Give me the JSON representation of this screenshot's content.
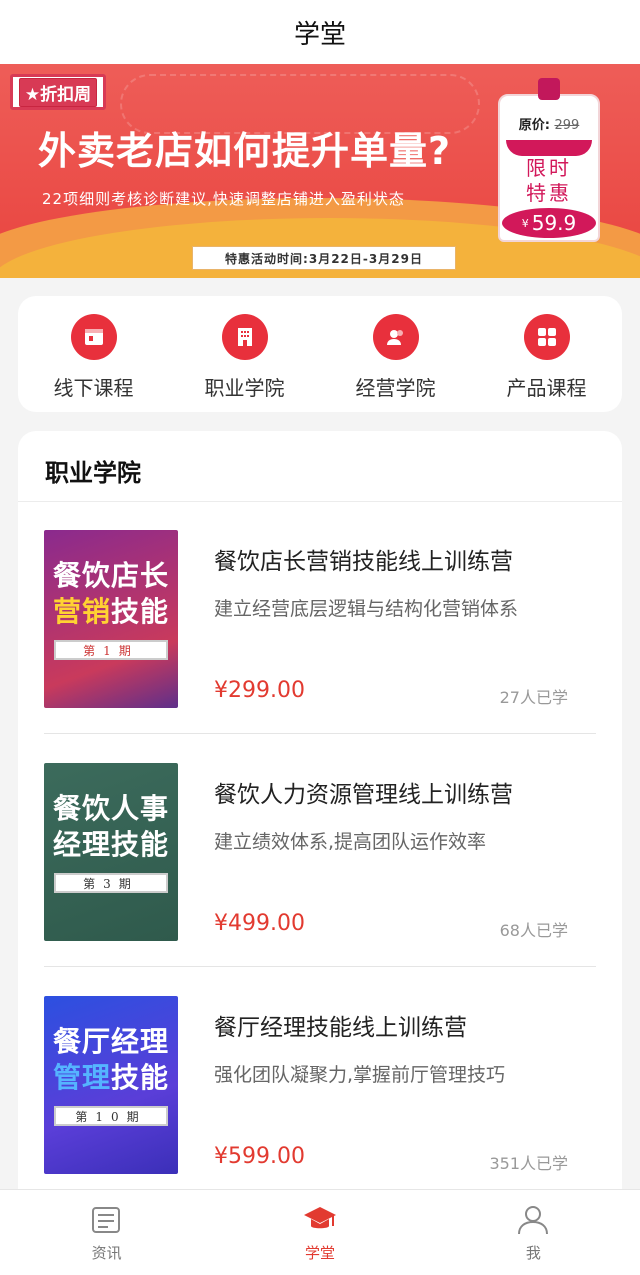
{
  "header": {
    "title": "学堂"
  },
  "banner": {
    "tag": "折扣周",
    "headline": "外卖老店如何提升单量?",
    "subline": "22项细则考核诊断建议,快速调整店铺进入盈利状态",
    "date_label": "特惠活动时间:",
    "date_range": "3月22日-3月29日",
    "pricetag": {
      "orig_label": "原价:",
      "orig_price": "299",
      "promo_line1": "限时",
      "promo_line2": "特惠",
      "yen": "¥",
      "price": "59.9"
    }
  },
  "categories": [
    {
      "label": "线下课程",
      "icon": "offline-course-icon"
    },
    {
      "label": "职业学院",
      "icon": "building-icon"
    },
    {
      "label": "经营学院",
      "icon": "users-icon"
    },
    {
      "label": "产品课程",
      "icon": "product-grid-icon"
    }
  ],
  "section": {
    "title": "职业学院",
    "courses": [
      {
        "name": "餐饮店长营销技能线上训练营",
        "desc": "建立经营底层逻辑与结构化营销体系",
        "price": "¥299.00",
        "learners": "27人已学",
        "cover": {
          "line1": "餐饮店长",
          "line2_a": "营销",
          "line2_b": "技能",
          "period": "第1期"
        }
      },
      {
        "name": "餐饮人力资源管理线上训练营",
        "desc": "建立绩效体系,提高团队运作效率",
        "price": "¥499.00",
        "learners": "68人已学",
        "cover": {
          "line1": "餐饮人事",
          "line2_a": "",
          "line2_b": "经理技能",
          "period": "第3期"
        }
      },
      {
        "name": "餐厅经理技能线上训练营",
        "desc": "强化团队凝聚力,掌握前厅管理技巧",
        "price": "¥599.00",
        "learners": "351人已学",
        "cover": {
          "line1": "餐厅经理",
          "line2_a": "管理",
          "line2_b": "技能",
          "period": "第10期"
        }
      }
    ]
  },
  "tabbar": {
    "items": [
      {
        "label": "资讯",
        "icon": "news-icon",
        "active": false
      },
      {
        "label": "学堂",
        "icon": "graduation-cap-icon",
        "active": true
      },
      {
        "label": "我",
        "icon": "user-icon",
        "active": false
      }
    ]
  },
  "colors": {
    "accent": "#e23a30",
    "banner": "#e9443f",
    "icon_bg": "#e8303c"
  }
}
